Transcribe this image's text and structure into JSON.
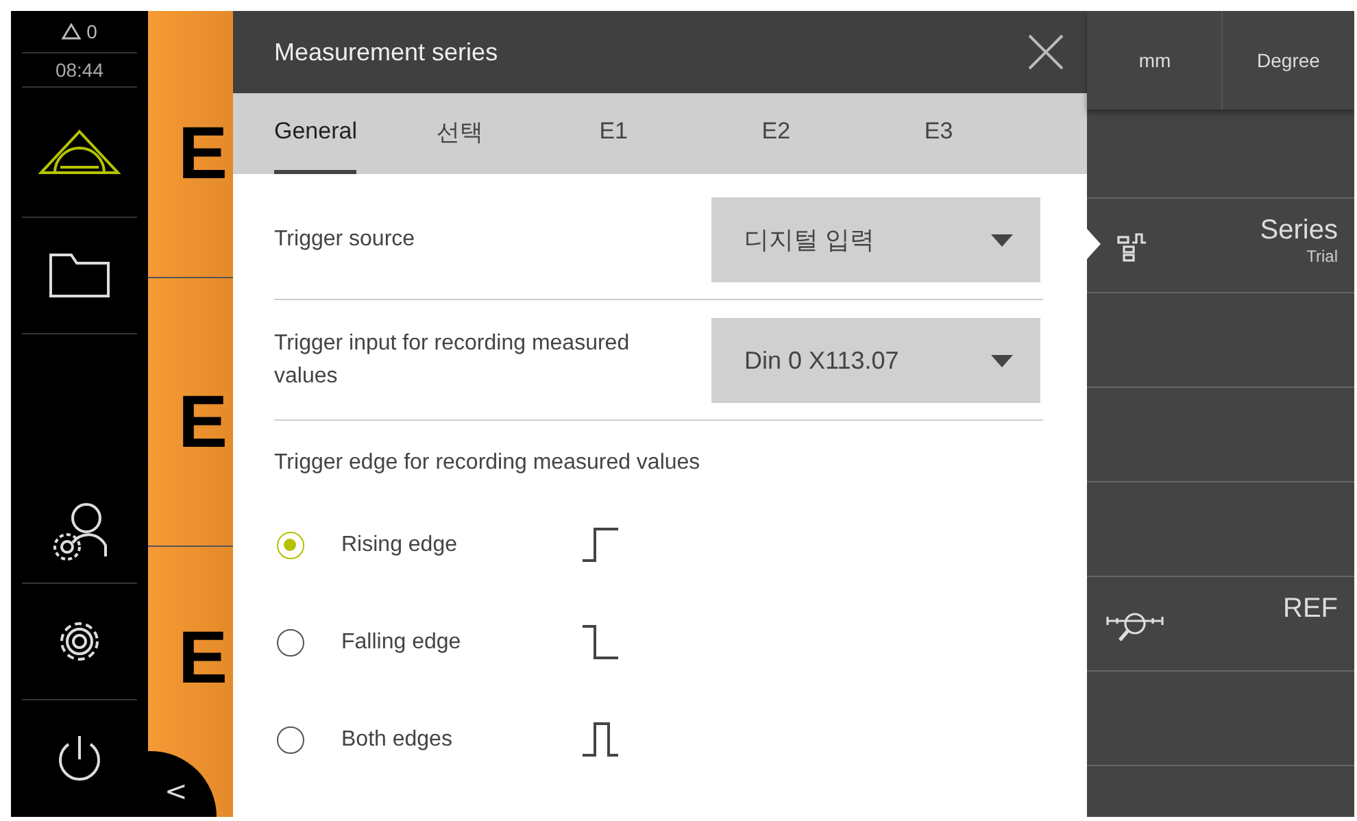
{
  "status": {
    "warnings": "0",
    "time": "08:44"
  },
  "sidebar": {
    "items": [
      {
        "kind": "measure",
        "selected": true
      },
      {
        "kind": "folder",
        "selected": false
      },
      {
        "kind": "user-settings",
        "selected": false
      },
      {
        "kind": "settings",
        "selected": false
      },
      {
        "kind": "power",
        "selected": false
      }
    ]
  },
  "feature_tiles": [
    {
      "label": "E"
    },
    {
      "label": "E"
    },
    {
      "label": "E"
    }
  ],
  "back_button": {
    "label": "<"
  },
  "dialog": {
    "title": "Measurement series",
    "tabs": [
      {
        "label": "General",
        "selected": true
      },
      {
        "label": "선택",
        "selected": false
      },
      {
        "label": "E1",
        "selected": false
      },
      {
        "label": "E2",
        "selected": false
      },
      {
        "label": "E3",
        "selected": false
      }
    ],
    "fields": [
      {
        "label": "Trigger source",
        "value": "디지털 입력"
      },
      {
        "label": "Trigger input for recording measured values",
        "value": "Din 0 X113.07"
      }
    ],
    "edge_group": {
      "heading": "Trigger edge for recording measured values",
      "options": [
        {
          "label": "Rising edge",
          "kind": "rising",
          "selected": true
        },
        {
          "label": "Falling edge",
          "kind": "falling",
          "selected": false
        },
        {
          "label": "Both edges",
          "kind": "both",
          "selected": false
        }
      ]
    }
  },
  "right_panel": {
    "units": [
      "mm",
      "Degree"
    ],
    "rows": [
      {
        "kind": "empty"
      },
      {
        "kind": "series",
        "title": "Series",
        "subtitle": "Trial",
        "selected": true
      },
      {
        "kind": "empty"
      },
      {
        "kind": "empty"
      },
      {
        "kind": "empty"
      },
      {
        "kind": "ref",
        "title": "REF"
      },
      {
        "kind": "empty"
      }
    ]
  }
}
